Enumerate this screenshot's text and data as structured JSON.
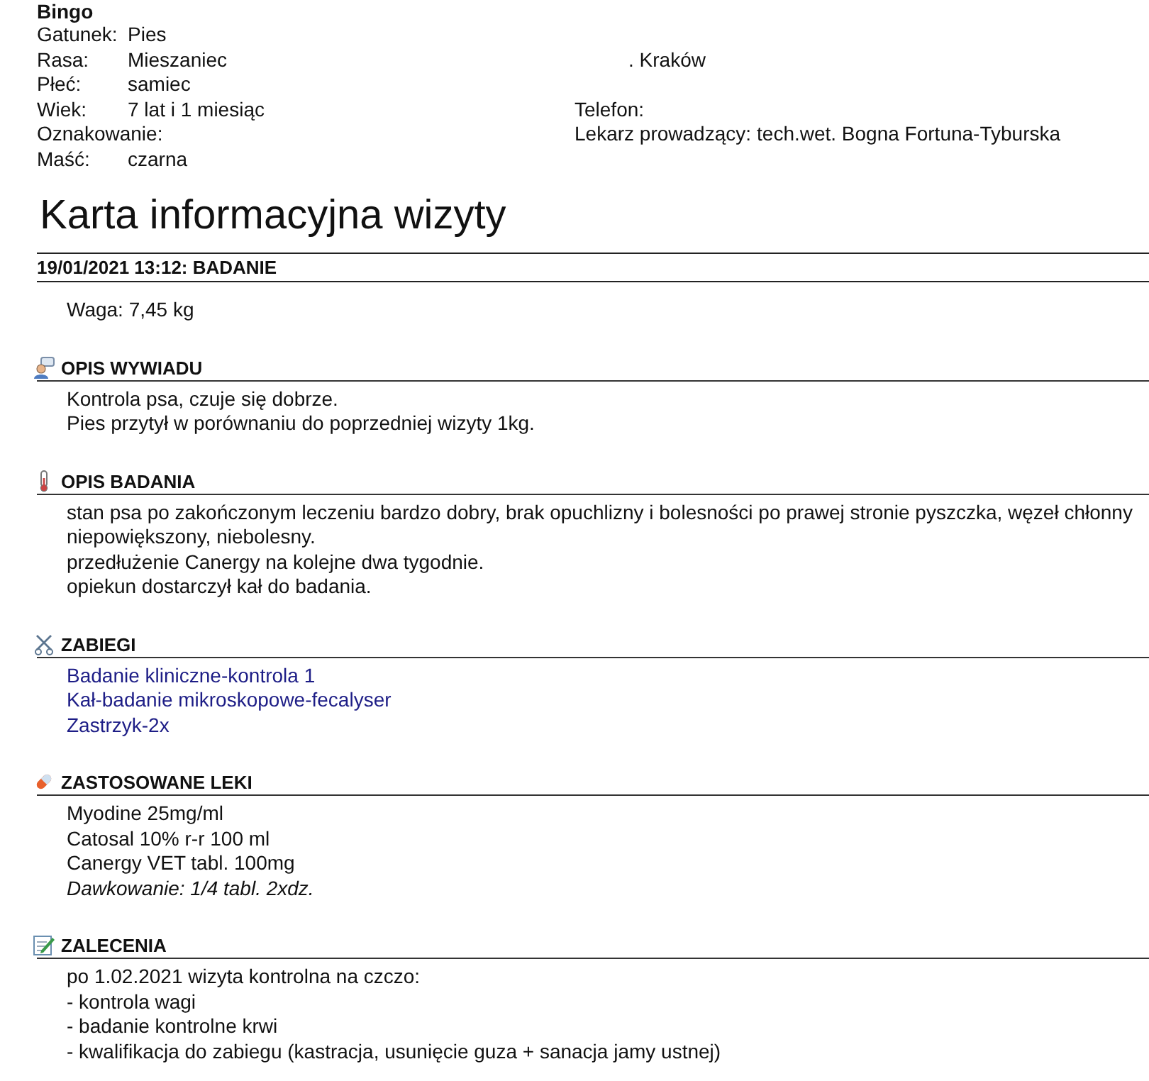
{
  "patient": {
    "name": "Bingo",
    "fields": [
      {
        "label": "Gatunek:",
        "value": "Pies"
      },
      {
        "label": "Rasa:",
        "value": "Mieszaniec"
      },
      {
        "label": "Płeć:",
        "value": "samiec"
      },
      {
        "label": "Wiek:",
        "value": "7 lat i 1 miesiąc"
      },
      {
        "label": "Oznakowanie:"
      },
      {
        "label": "Maść:",
        "value": "czarna"
      }
    ]
  },
  "owner": {
    "address": ". Kraków",
    "phone_label": "Telefon:",
    "vet_label": "Lekarz prowadzący:",
    "vet": "tech.wet. Bogna Fortuna-Tyburska"
  },
  "title": "Karta informacyjna wizyty",
  "visit": {
    "header": "19/01/2021 13:12: BADANIE",
    "weight": "Waga: 7,45 kg"
  },
  "sections": [
    {
      "kind": "interview",
      "title": "OPIS WYWIADU",
      "lines": [
        {
          "kind": "plain",
          "text": "Kontrola psa, czuje się dobrze."
        },
        {
          "kind": "plain",
          "text": "Pies przytył w porównaniu do poprzedniej wizyty 1kg."
        }
      ]
    },
    {
      "kind": "exam",
      "title": "OPIS BADANIA",
      "lines": [
        {
          "kind": "plain",
          "text": "stan psa po zakończonym leczeniu bardzo dobry, brak opuchlizny i bolesności po prawej stronie pyszczka, węzeł chłonny niepowiększony, niebolesny."
        },
        {
          "kind": "plain",
          "text": "przedłużenie Canergy na kolejne dwa tygodnie."
        },
        {
          "kind": "plain",
          "text": "opiekun dostarczył kał do badania."
        }
      ]
    },
    {
      "kind": "procedures",
      "title": "ZABIEGI",
      "lines": [
        {
          "kind": "link",
          "text": "Badanie kliniczne-kontrola 1"
        },
        {
          "kind": "link",
          "text": "Kał-badanie mikroskopowe-fecalyser"
        },
        {
          "kind": "link",
          "text": "Zastrzyk-2x"
        }
      ]
    },
    {
      "kind": "medication",
      "title": "ZASTOSOWANE LEKI",
      "lines": [
        {
          "kind": "plain",
          "text": "Myodine 25mg/ml"
        },
        {
          "kind": "plain",
          "text": "Catosal 10% r-r 100 ml"
        },
        {
          "kind": "plain",
          "text": "Canergy VET tabl. 100mg"
        },
        {
          "kind": "note",
          "text": "Dawkowanie: 1/4 tabl. 2xdz."
        }
      ]
    },
    {
      "kind": "recommendations",
      "title": "ZALECENIA",
      "lines": [
        {
          "kind": "plain",
          "text": "po 1.02.2021 wizyta kontrolna na czczo:"
        },
        {
          "kind": "plain",
          "text": "- kontrola wagi"
        },
        {
          "kind": "plain",
          "text": "- badanie kontrolne krwi"
        },
        {
          "kind": "plain",
          "text": "- kwalifikacja do zabiegu (kastracja, usunięcie guza + sanacja jamy ustnej)"
        }
      ]
    }
  ]
}
